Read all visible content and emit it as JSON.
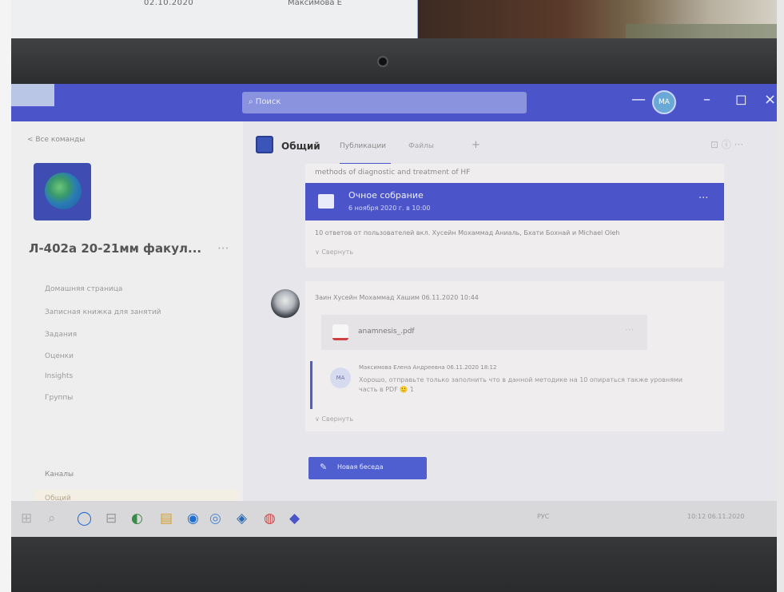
{
  "top_paper": {
    "left_text": "02.10.2020",
    "right_text": "Максимова Е"
  },
  "titlebar": {
    "search_placeholder": "Поиск",
    "minimize": "—",
    "avatar_initials": "МА",
    "restore": "–",
    "maximize": "◻",
    "close": "×"
  },
  "sidebar": {
    "back_label": "< Все команды",
    "team_name": "Л-402а 20-21мм факул...",
    "more": "···",
    "nav_items": [
      "Домашняя страница",
      "Записная книжка для занятий",
      "Задания",
      "Оценки",
      "Insights",
      "Группы"
    ],
    "channels_label": "Каналы",
    "channel_general": "Общий"
  },
  "channel": {
    "title": "Общий",
    "tab_posts": "Публикации",
    "tab_files": "Файлы",
    "tab_add": "+",
    "header_icons": "⊡ ⓘ ···"
  },
  "post1": {
    "text": "methods of diagnostic and treatment of HF",
    "meeting_title": "Очное собрание",
    "meeting_date": "6 ноября 2020 г. в 10:00",
    "meeting_more": "···",
    "attendance": "10 ответов от пользователей вкл. Хусейн Мохаммад Аниаль, Бхати Бохнай и Michael Oleh",
    "collapse": "∨ Свернуть"
  },
  "post2": {
    "author_line": "Заин Хусейн Мохаммад Хашим  06.11.2020 10:44",
    "file_name": "anamnesis_.pdf",
    "file_more": "···",
    "reply_avatar": "МА",
    "reply_author": "Максимова Елена Андреевна  06.11.2020 18:12",
    "reply_text": "Хорошо, отправьте только заполнить что в данной методике на 10 опираться также уровнями часть в PDF 🙂 1",
    "collapse": "∨ Свернуть"
  },
  "new_conversation": {
    "icon": "✎",
    "label": "Новая беседа"
  },
  "taskbar": {
    "icons": [
      "⊞",
      "⌕",
      "◯",
      "⊟",
      "◐",
      "▤",
      "◉",
      "◎",
      "◈",
      "◍",
      "◆"
    ],
    "tray_lang": "РУС",
    "tray_time": "10:12 06.11.2020"
  },
  "colors": {
    "accent": "#4b55c9",
    "title_bar": "#4b55c9",
    "meeting_card": "#4b55c9"
  }
}
